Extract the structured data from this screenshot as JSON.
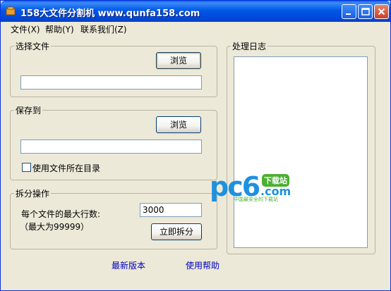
{
  "window": {
    "title": "158大文件分割机 www.qunfa158.com",
    "controls": [
      "minimize",
      "maximize",
      "close"
    ]
  },
  "menu": {
    "file": "文件(X)",
    "help": "帮助(Y)",
    "contact": "联系我们(Z)"
  },
  "select_file": {
    "legend": "选择文件",
    "browse_label": "浏览",
    "path_value": ""
  },
  "save_to": {
    "legend": "保存到",
    "browse_label": "浏览",
    "path_value": "",
    "use_source_dir_label": "使用文件所在目录",
    "use_source_dir_checked": false
  },
  "split": {
    "legend": "拆分操作",
    "max_lines_label": "每个文件的最大行数:",
    "max_lines_value": "3000",
    "max_hint": "（最大为99999）",
    "split_now_label": "立即拆分"
  },
  "log": {
    "legend": "处理日志",
    "content": ""
  },
  "links": {
    "latest_version": "最新版本",
    "usage_help": "使用帮助"
  },
  "watermark": {
    "brand": "pc6",
    "badge": "下载站",
    "domain": ".com",
    "tagline": "中国最安全的下载站"
  }
}
